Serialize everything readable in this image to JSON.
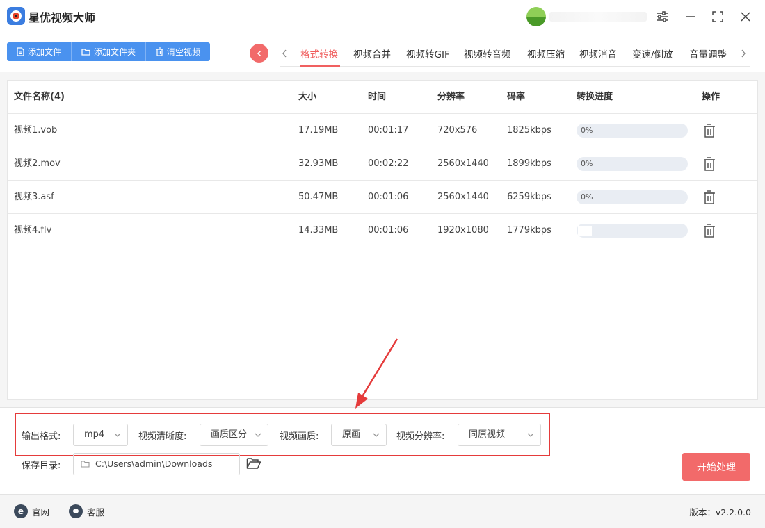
{
  "app": {
    "title": "星优视频大师"
  },
  "toolbar": {
    "add_file": "添加文件",
    "add_folder": "添加文件夹",
    "clear": "清空视频"
  },
  "tabs": [
    "格式转换",
    "视频合并",
    "视频转GIF",
    "视频转音频",
    "视频压缩",
    "视频消音",
    "变速/倒放",
    "音量调整"
  ],
  "active_tab": "格式转换",
  "table": {
    "headers": {
      "name": "文件名称(4)",
      "size": "大小",
      "time": "时间",
      "resolution": "分辨率",
      "bitrate": "码率",
      "progress": "转换进度",
      "action": "操作"
    },
    "rows": [
      {
        "name": "视频1.vob",
        "size": "17.19MB",
        "time": "00:01:17",
        "resolution": "720x576",
        "bitrate": "1825kbps",
        "progress": "0%",
        "progress_value": 0
      },
      {
        "name": "视频2.mov",
        "size": "32.93MB",
        "time": "00:02:22",
        "resolution": "2560x1440",
        "bitrate": "1899kbps",
        "progress": "0%",
        "progress_value": 0
      },
      {
        "name": "视频3.asf",
        "size": "50.47MB",
        "time": "00:01:06",
        "resolution": "2560x1440",
        "bitrate": "6259kbps",
        "progress": "0%",
        "progress_value": 0
      },
      {
        "name": "视频4.flv",
        "size": "14.33MB",
        "time": "00:01:06",
        "resolution": "1920x1080",
        "bitrate": "1779kbps",
        "progress": "",
        "progress_value": 0
      }
    ]
  },
  "settings": {
    "format_label": "输出格式:",
    "format_value": "mp4",
    "clarity_label": "视频清晰度:",
    "clarity_value": "画质区分",
    "quality_label": "视频画质:",
    "quality_value": "原画",
    "resolution_label": "视频分辨率:",
    "resolution_value": "同原视频",
    "save_label": "保存目录:",
    "save_path": "C:\\Users\\admin\\Downloads",
    "start": "开始处理"
  },
  "footer": {
    "website": "官网",
    "support": "客服",
    "version": "版本：v2.2.0.0"
  },
  "colors": {
    "accent_blue": "#4a92ef",
    "accent_red": "#f26a6a",
    "annotation_red": "#e53b3b"
  }
}
